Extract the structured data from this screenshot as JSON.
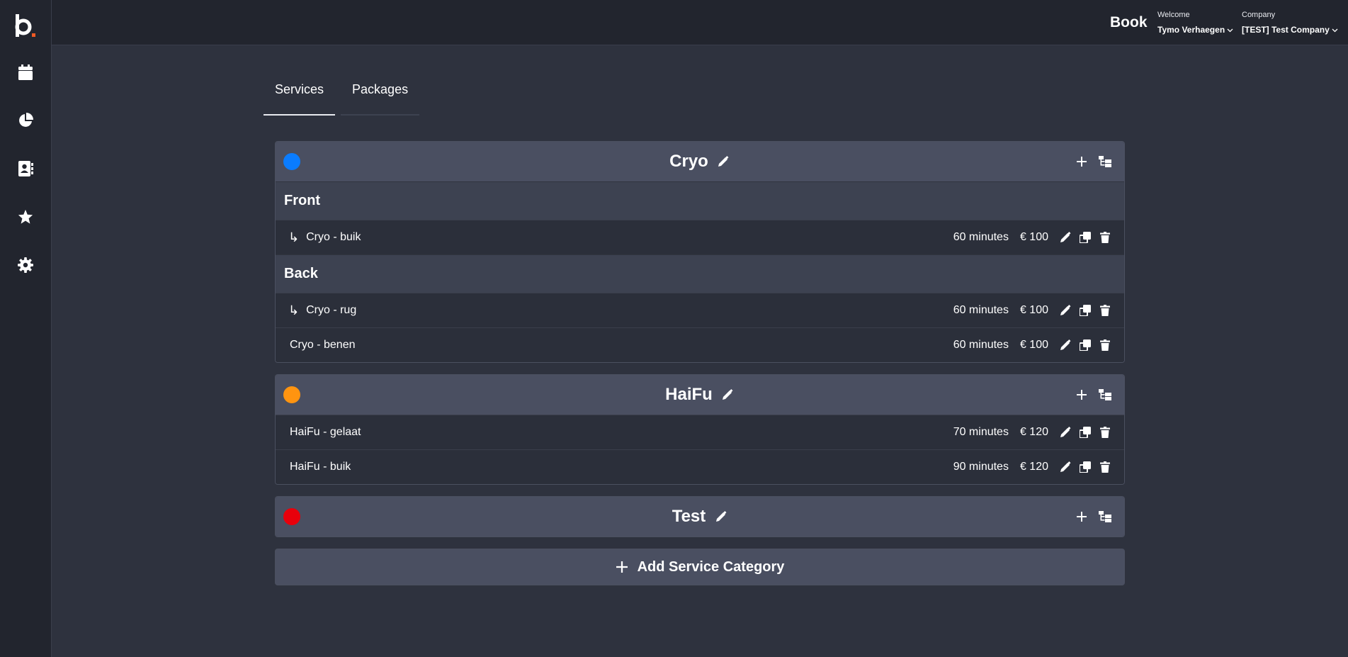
{
  "sidebar": {
    "logo_icon": "b-logo-icon",
    "items": [
      {
        "name": "calendar",
        "icon": "calendar-icon"
      },
      {
        "name": "reports",
        "icon": "pie-chart-icon"
      },
      {
        "name": "contacts",
        "icon": "address-book-icon"
      },
      {
        "name": "favorites",
        "icon": "star-icon"
      },
      {
        "name": "settings",
        "icon": "gear-icon"
      }
    ]
  },
  "header": {
    "book_label": "Book",
    "welcome_label": "Welcome",
    "user_name": "Tymo Verhaegen",
    "company_label": "Company",
    "company_name": "[TEST] Test Company"
  },
  "tabs": [
    {
      "label": "Services",
      "active": true
    },
    {
      "label": "Packages",
      "active": false
    }
  ],
  "categories": [
    {
      "title": "Cryo",
      "color": "#0a7cff",
      "groups": [
        {
          "subheader": "Front",
          "services": [
            {
              "name": "Cryo - buik",
              "duration": "60 minutes",
              "price": "€ 100",
              "indented": true
            }
          ]
        },
        {
          "subheader": "Back",
          "services": [
            {
              "name": "Cryo - rug",
              "duration": "60 minutes",
              "price": "€ 100",
              "indented": true
            },
            {
              "name": "Cryo - benen",
              "duration": "60 minutes",
              "price": "€ 100",
              "indented": false
            }
          ]
        }
      ]
    },
    {
      "title": "HaiFu",
      "color": "#ff9410",
      "groups": [
        {
          "subheader": "",
          "services": [
            {
              "name": "HaiFu - gelaat",
              "duration": "70 minutes",
              "price": "€ 120",
              "indented": false
            },
            {
              "name": "HaiFu - buik",
              "duration": "90 minutes",
              "price": "€ 120",
              "indented": false
            }
          ]
        }
      ]
    },
    {
      "title": "Test",
      "color": "#e8000b",
      "groups": []
    }
  ],
  "add_category_label": "Add Service Category",
  "arrow_glyph": "↳",
  "accent_colors": {
    "logo_dot": "#f15a24"
  }
}
